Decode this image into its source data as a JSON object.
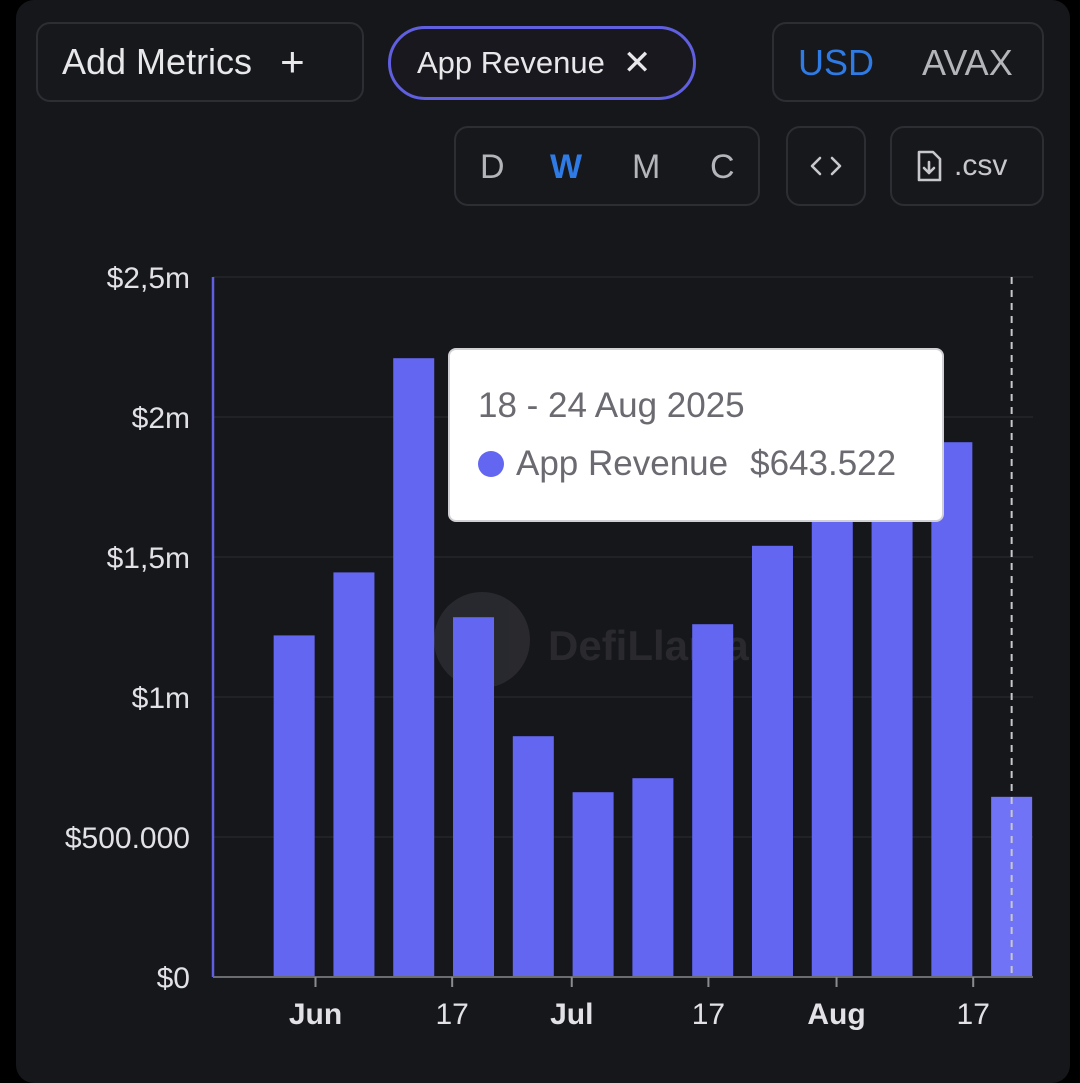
{
  "toolbar": {
    "add_metrics_label": "Add Metrics",
    "add_metrics_icon": "plus-icon",
    "selected_metric": "App Revenue",
    "remove_metric_icon": "close-icon",
    "currency_options": [
      "USD",
      "AVAX"
    ],
    "currency_selected": "USD",
    "period_options": [
      "D",
      "W",
      "M",
      "C"
    ],
    "period_selected": "W",
    "embed_icon": "code-icon",
    "csv_label": ".csv",
    "csv_icon": "file-download-icon"
  },
  "colors": {
    "bar": "#6366f1",
    "bar_highlight": "#7073f5",
    "accent_blue": "#2f7be6",
    "chip_border": "#5f5fe0"
  },
  "watermark": "DefiLlama",
  "tooltip": {
    "date": "18 - 24 Aug 2025",
    "series": "App Revenue",
    "value": "$643.522"
  },
  "chart_data": {
    "type": "bar",
    "title": "",
    "xlabel": "",
    "ylabel": "",
    "categories": [
      "2025-05-26",
      "2025-06-02",
      "2025-06-09",
      "2025-06-16",
      "2025-06-23",
      "2025-06-30",
      "2025-07-07",
      "2025-07-14",
      "2025-07-21",
      "2025-07-28",
      "2025-08-04",
      "2025-08-11",
      "2025-08-18"
    ],
    "series": [
      {
        "name": "App Revenue",
        "values": [
          1220000,
          1445000,
          2210000,
          1285000,
          860000,
          660000,
          710000,
          1260000,
          1540000,
          1850000,
          1880000,
          1910000,
          643522
        ]
      }
    ],
    "ylim": [
      0,
      2500000
    ],
    "y_ticks": [
      {
        "value": 0,
        "label": "$0"
      },
      {
        "value": 500000,
        "label": "$500.000"
      },
      {
        "value": 1000000,
        "label": "$1m"
      },
      {
        "value": 1500000,
        "label": "$1,5m"
      },
      {
        "value": 2000000,
        "label": "$2m"
      },
      {
        "value": 2500000,
        "label": "$2,5m"
      }
    ],
    "x_ticks": [
      {
        "date": "2025-06-01",
        "label": "Jun",
        "bold": true
      },
      {
        "date": "2025-06-17",
        "label": "17",
        "bold": false
      },
      {
        "date": "2025-07-01",
        "label": "Jul",
        "bold": true
      },
      {
        "date": "2025-07-17",
        "label": "17",
        "bold": false
      },
      {
        "date": "2025-08-01",
        "label": "Aug",
        "bold": true
      },
      {
        "date": "2025-08-17",
        "label": "17",
        "bold": false
      }
    ],
    "highlighted_category": "2025-08-18",
    "grid": true,
    "legend": "none"
  }
}
